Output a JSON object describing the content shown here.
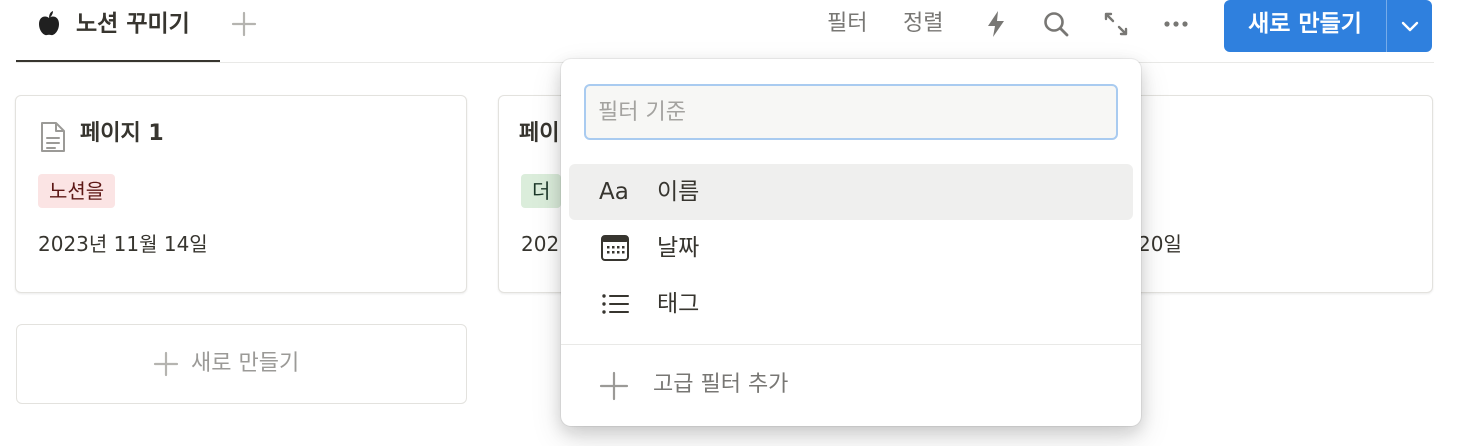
{
  "toolbar": {
    "tab_label": "노션 꾸미기",
    "filter_label": "필터",
    "sort_label": "정렬",
    "new_button_label": "새로 만들기",
    "accent_color": "#2f80de"
  },
  "cards": [
    {
      "title": "페이지 1",
      "tag": "노션을",
      "tag_bg": "#fbe4e4",
      "tag_color": "#5d1715",
      "date": "2023년 11월 14일"
    },
    {
      "title": "페이",
      "tag": "더",
      "tag_bg": "#dbeddb",
      "tag_color": "#1c3829",
      "date": "202"
    },
    {
      "title": "",
      "tag": "",
      "date": "20일"
    }
  ],
  "new_card": {
    "label": "새로 만들기"
  },
  "filter_popup": {
    "search_placeholder": "필터 기준",
    "search_value": "",
    "properties": [
      {
        "icon": "text-property-icon",
        "icon_text": "Aa",
        "label": "이름"
      },
      {
        "icon": "calendar-icon",
        "label": "날짜"
      },
      {
        "icon": "list-icon",
        "label": "태그"
      }
    ],
    "advanced_label": "고급 필터 추가"
  }
}
